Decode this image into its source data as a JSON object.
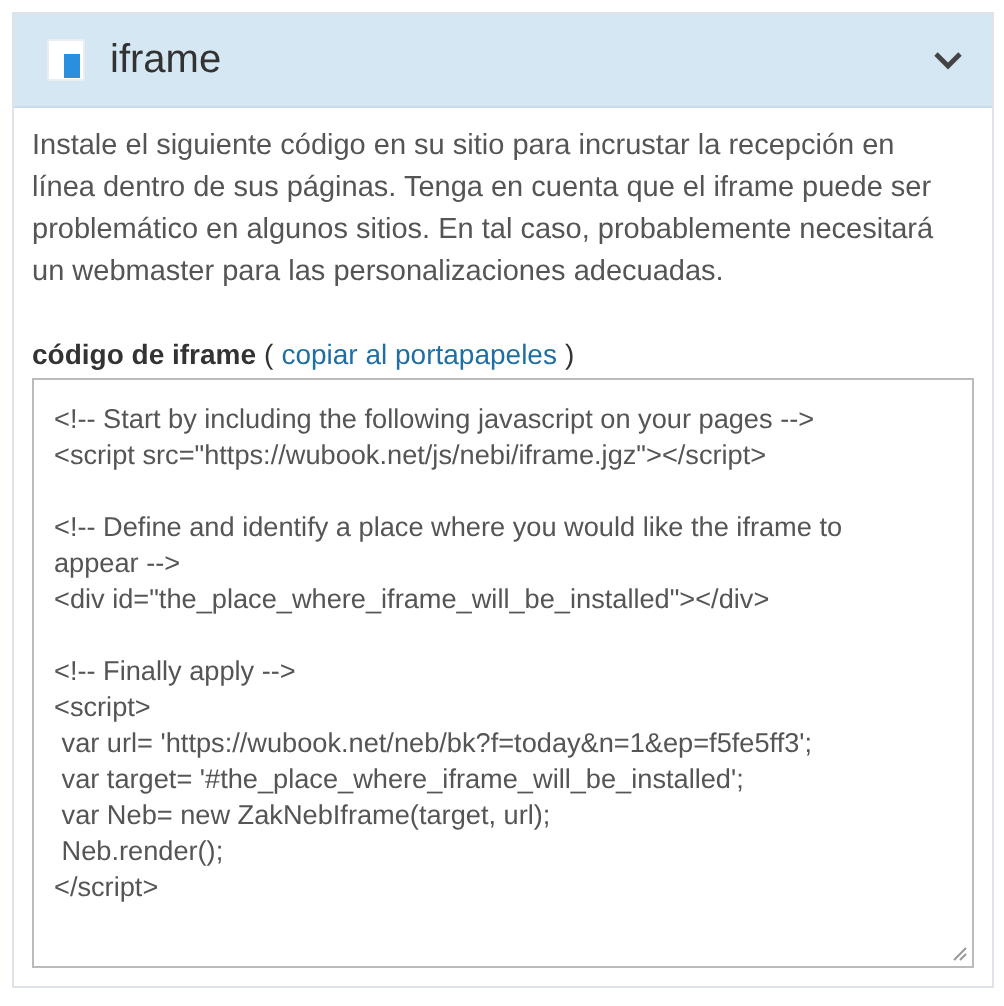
{
  "panel": {
    "title": "iframe",
    "expanded": true
  },
  "description": "Instale el siguiente código en su sitio para incrustar la recepción en línea dentro de sus páginas. Tenga en cuenta que el iframe puede ser problemático en algunos sitios. En tal caso, probablemente necesitará un webmaster para las personalizaciones adecuadas.",
  "code_label": "código de iframe",
  "copy_link": {
    "open": "(",
    "text": "copiar al portapapeles",
    "close": ")"
  },
  "code_blocks": [
    [
      "<!-- Start by including the following javascript on your pages -->",
      "<script src=\"https://wubook.net/js/nebi/iframe.jgz\"></script>"
    ],
    [
      "<!-- Define and identify a place where you would like the iframe to",
      "appear -->",
      "<div id=\"the_place_where_iframe_will_be_installed\"></div>"
    ],
    [
      "<!-- Finally apply -->",
      "<script>",
      " var url= 'https://wubook.net/neb/bk?f=today&n=1&ep=f5fe5ff3';",
      " var target= '#the_place_where_iframe_will_be_installed';",
      " var Neb= new ZakNebIframe(target, url);",
      " Neb.render();",
      "</script>"
    ]
  ]
}
